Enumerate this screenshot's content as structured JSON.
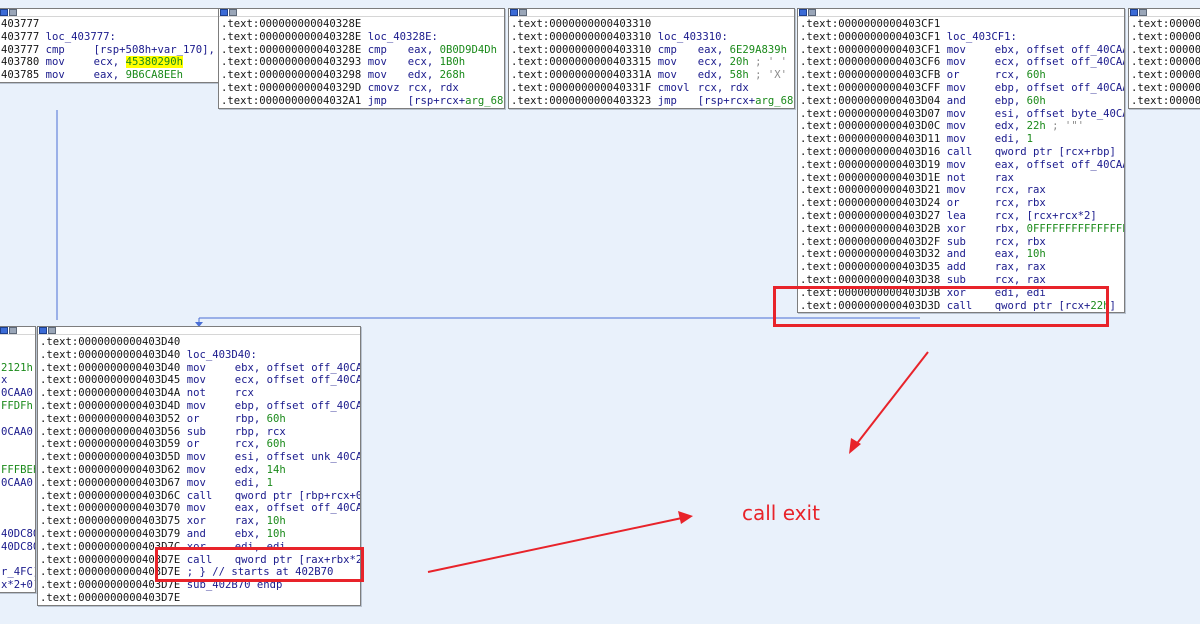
{
  "blocks": [
    {
      "id": "blk-403777",
      "lines": [
        {
          "addr": "403777",
          "mn": "",
          "op": ""
        },
        {
          "addr": "403777",
          "mn": "loc_403777:",
          "op": ""
        },
        {
          "addr": "403777",
          "mn": "cmp",
          "op": "[rsp+508h+var_170], 1"
        },
        {
          "addr": "403780",
          "mn": "mov",
          "op": "ecx, ",
          "hl": "45380290h"
        },
        {
          "addr": "403785",
          "mn": "mov",
          "op": "eax, ",
          "hx": "9B6CA8EEh"
        }
      ]
    },
    {
      "id": "blk-40328E",
      "lines": [
        {
          "addr": ".text:000000000040328E",
          "mn": "",
          "op": ""
        },
        {
          "addr": ".text:000000000040328E",
          "mn": "loc_40328E:",
          "op": ""
        },
        {
          "addr": ".text:000000000040328E",
          "mn": "cmp",
          "op": "eax, ",
          "hx": "0B0D9D4Dh"
        },
        {
          "addr": ".text:0000000000403293",
          "mn": "mov",
          "op": "ecx, ",
          "hx": "1B0h"
        },
        {
          "addr": ".text:0000000000403298",
          "mn": "mov",
          "op": "edx, ",
          "hx": "268h"
        },
        {
          "addr": ".text:000000000040329D",
          "mn": "cmovz",
          "op": "rcx, rdx"
        },
        {
          "addr": ".text:00000000004032A1",
          "mn": "jmp",
          "op": "[rsp+rcx+",
          "hx": "arg_68",
          "tail": "]"
        }
      ]
    },
    {
      "id": "blk-403310",
      "lines": [
        {
          "addr": ".text:0000000000403310",
          "mn": "",
          "op": ""
        },
        {
          "addr": ".text:0000000000403310",
          "mn": "loc_403310:",
          "op": ""
        },
        {
          "addr": ".text:0000000000403310",
          "mn": "cmp",
          "op": "eax, ",
          "hx": "6E29A839h"
        },
        {
          "addr": ".text:0000000000403315",
          "mn": "mov",
          "op": "ecx, ",
          "hx": "20h",
          "cm": " ; ' '"
        },
        {
          "addr": ".text:000000000040331A",
          "mn": "mov",
          "op": "edx, ",
          "hx": "58h",
          "cm": " ; 'X'"
        },
        {
          "addr": ".text:000000000040331F",
          "mn": "cmovl",
          "op": "rcx, rdx"
        },
        {
          "addr": ".text:0000000000403323",
          "mn": "jmp",
          "op": "[rsp+rcx+",
          "hx": "arg_68",
          "tail": "]"
        }
      ]
    },
    {
      "id": "blk-403CF1",
      "lines": [
        {
          "addr": ".text:0000000000403CF1",
          "mn": "",
          "op": ""
        },
        {
          "addr": ".text:0000000000403CF1",
          "mn": "loc_403CF1:",
          "op": ""
        },
        {
          "addr": ".text:0000000000403CF1",
          "mn": "mov",
          "op": "ebx, offset off_40CAA0"
        },
        {
          "addr": ".text:0000000000403CF6",
          "mn": "mov",
          "op": "ecx, offset off_40CAA0"
        },
        {
          "addr": ".text:0000000000403CFB",
          "mn": "or",
          "op": "rcx, ",
          "hx": "60h"
        },
        {
          "addr": ".text:0000000000403CFF",
          "mn": "mov",
          "op": "ebp, offset off_40CAA0"
        },
        {
          "addr": ".text:0000000000403D04",
          "mn": "and",
          "op": "ebp, ",
          "hx": "60h"
        },
        {
          "addr": ".text:0000000000403D07",
          "mn": "mov",
          "op": "esi, offset byte_40CA10"
        },
        {
          "addr": ".text:0000000000403D0C",
          "mn": "mov",
          "op": "edx, ",
          "hx": "22h",
          "cm": " ; '\"'"
        },
        {
          "addr": ".text:0000000000403D11",
          "mn": "mov",
          "op": "edi, ",
          "hx": "1"
        },
        {
          "addr": ".text:0000000000403D16",
          "mn": "call",
          "op": "qword ptr [rcx+rbp]"
        },
        {
          "addr": ".text:0000000000403D19",
          "mn": "mov",
          "op": "eax, offset off_40CAA0"
        },
        {
          "addr": ".text:0000000000403D1E",
          "mn": "not",
          "op": "rax"
        },
        {
          "addr": ".text:0000000000403D21",
          "mn": "mov",
          "op": "rcx, rax"
        },
        {
          "addr": ".text:0000000000403D24",
          "mn": "or",
          "op": "rcx, rbx"
        },
        {
          "addr": ".text:0000000000403D27",
          "mn": "lea",
          "op": "rcx, [rcx+rcx*2]"
        },
        {
          "addr": ".text:0000000000403D2B",
          "mn": "xor",
          "op": "rbx, ",
          "hx": "0FFFFFFFFFFFFFFEFh"
        },
        {
          "addr": ".text:0000000000403D2F",
          "mn": "sub",
          "op": "rcx, rbx"
        },
        {
          "addr": ".text:0000000000403D32",
          "mn": "and",
          "op": "eax, ",
          "hx": "10h"
        },
        {
          "addr": ".text:0000000000403D35",
          "mn": "add",
          "op": "rax, rax"
        },
        {
          "addr": ".text:0000000000403D38",
          "mn": "sub",
          "op": "rcx, rax"
        },
        {
          "addr": ".text:0000000000403D3B",
          "mn": "xor",
          "op": "edi, edi"
        },
        {
          "addr": ".text:0000000000403D3D",
          "mn": "call",
          "op": "qword ptr [rcx+",
          "hx": "22h",
          "tail": "]"
        }
      ]
    },
    {
      "id": "blk-403D40",
      "lines": [
        {
          "addr": ".text:0000000000403D40",
          "mn": "",
          "op": ""
        },
        {
          "addr": ".text:0000000000403D40",
          "mn": "loc_403D40:",
          "op": ""
        },
        {
          "addr": ".text:0000000000403D40",
          "mn": "mov",
          "op": "ebx, offset off_40CAA0"
        },
        {
          "addr": ".text:0000000000403D45",
          "mn": "mov",
          "op": "ecx, offset off_40CAA0"
        },
        {
          "addr": ".text:0000000000403D4A",
          "mn": "not",
          "op": "rcx"
        },
        {
          "addr": ".text:0000000000403D4D",
          "mn": "mov",
          "op": "ebp, offset off_40CAA0"
        },
        {
          "addr": ".text:0000000000403D52",
          "mn": "or",
          "op": "rbp, ",
          "hx": "60h"
        },
        {
          "addr": ".text:0000000000403D56",
          "mn": "sub",
          "op": "rbp, rcx"
        },
        {
          "addr": ".text:0000000000403D59",
          "mn": "or",
          "op": "rcx, ",
          "hx": "60h"
        },
        {
          "addr": ".text:0000000000403D5D",
          "mn": "mov",
          "op": "esi, offset unk_40CA40"
        },
        {
          "addr": ".text:0000000000403D62",
          "mn": "mov",
          "op": "edx, ",
          "hx": "14h"
        },
        {
          "addr": ".text:0000000000403D67",
          "mn": "mov",
          "op": "edi, ",
          "hx": "1"
        },
        {
          "addr": ".text:0000000000403D6C",
          "mn": "call",
          "op": "qword ptr [rbp+rcx+0]"
        },
        {
          "addr": ".text:0000000000403D70",
          "mn": "mov",
          "op": "eax, offset off_40CAA0"
        },
        {
          "addr": ".text:0000000000403D75",
          "mn": "xor",
          "op": "rax, ",
          "hx": "10h"
        },
        {
          "addr": ".text:0000000000403D79",
          "mn": "and",
          "op": "ebx, ",
          "hx": "10h"
        },
        {
          "addr": ".text:0000000000403D7C",
          "mn": "xor",
          "op": "edi, edi"
        },
        {
          "addr": ".text:0000000000403D7E",
          "mn": "call",
          "op": "qword ptr [rax+rbx*2]"
        },
        {
          "addr": ".text:0000000000403D7E",
          "mn": "; } // starts at 402B70",
          "op": ""
        },
        {
          "addr": ".text:0000000000403D7E",
          "mn": "sub_402B70 endp",
          "op": ""
        },
        {
          "addr": ".text:0000000000403D7E",
          "mn": "",
          "op": ""
        }
      ]
    },
    {
      "id": "blk-left-partial",
      "lines": [
        {
          "addr": "",
          "mn": "",
          "op": ""
        },
        {
          "addr": "",
          "mn": "",
          "op": ""
        },
        {
          "addr": "",
          "mn": "",
          "op": "",
          "hx": "2121h"
        },
        {
          "addr": "",
          "mn": "",
          "op": "x"
        },
        {
          "addr": "",
          "mn": "",
          "op": "0CAA0"
        },
        {
          "addr": "",
          "mn": "",
          "op": "",
          "hx": "FFDFh"
        },
        {
          "addr": "",
          "mn": "",
          "op": ""
        },
        {
          "addr": "",
          "mn": "",
          "op": "0CAA0"
        },
        {
          "addr": "",
          "mn": "",
          "op": ""
        },
        {
          "addr": "",
          "mn": "",
          "op": ""
        },
        {
          "addr": "",
          "mn": "",
          "op": "",
          "hx": "FFFBEh"
        },
        {
          "addr": "",
          "mn": "",
          "op": "0CAA0"
        },
        {
          "addr": "",
          "mn": "",
          "op": ""
        },
        {
          "addr": "",
          "mn": "",
          "op": ""
        },
        {
          "addr": "",
          "mn": "",
          "op": ""
        },
        {
          "addr": "",
          "mn": "",
          "op": "40DC80"
        },
        {
          "addr": "",
          "mn": "",
          "op": "40DC80"
        },
        {
          "addr": "",
          "mn": "",
          "op": ""
        },
        {
          "addr": "",
          "mn": "",
          "op": "r_4FC]"
        },
        {
          "addr": "",
          "mn": "",
          "op": "x*2+0]"
        }
      ]
    },
    {
      "id": "blk-right-partial",
      "lines": [
        {
          "addr": ".text:000000",
          "mn": "",
          "op": ""
        },
        {
          "addr": ".text:000000",
          "mn": "",
          "op": ""
        },
        {
          "addr": ".text:000000",
          "mn": "",
          "op": ""
        },
        {
          "addr": ".text:000000",
          "mn": "",
          "op": ""
        },
        {
          "addr": ".text:000000",
          "mn": "",
          "op": ""
        },
        {
          "addr": ".text:000000",
          "mn": "",
          "op": ""
        },
        {
          "addr": ".text:000000",
          "mn": "",
          "op": ""
        }
      ]
    }
  ],
  "annotation": {
    "label": "call exit",
    "color": "#e8232a"
  }
}
